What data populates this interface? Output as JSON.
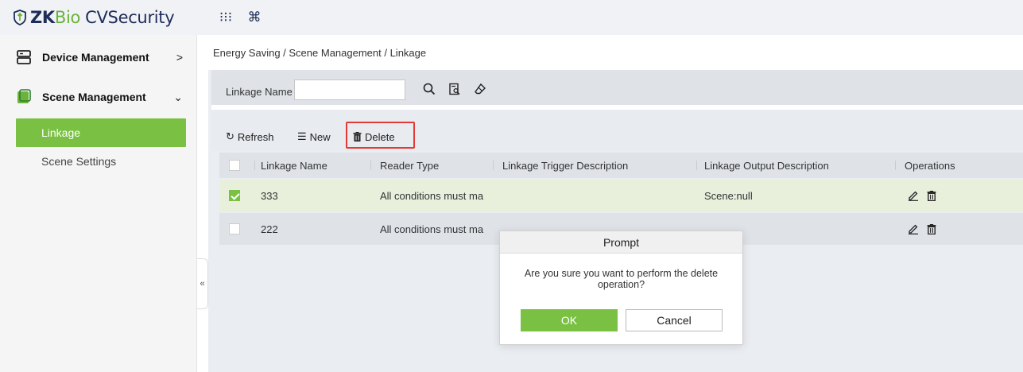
{
  "app": {
    "logo_zk": "ZK",
    "logo_bio": "Bio",
    "logo_cvs": "CVSecurity",
    "grid_icon": "⁝⁝⁝",
    "cmd_icon": "⌘"
  },
  "sidebar": {
    "device_management": "Device Management",
    "scene_management": "Scene Management",
    "sub_items": [
      {
        "label": "Linkage",
        "active": true
      },
      {
        "label": "Scene Settings",
        "active": false
      }
    ],
    "collapse_glyph": "«"
  },
  "breadcrumb": "Energy Saving / Scene Management / Linkage",
  "search": {
    "label": "Linkage Name",
    "value": "",
    "placeholder": ""
  },
  "toolbar": {
    "refresh": "Refresh",
    "new": "New",
    "delete": "Delete"
  },
  "table": {
    "columns": [
      "Linkage Name",
      "Reader Type",
      "Linkage Trigger Description",
      "Linkage Output Description",
      "Operations"
    ],
    "rows": [
      {
        "checked": true,
        "name": "333",
        "reader_type": "All conditions must ma",
        "trigger": "",
        "output": "Scene:null"
      },
      {
        "checked": false,
        "name": "222",
        "reader_type": "All conditions must ma",
        "trigger": "",
        "output": ""
      }
    ]
  },
  "dialog": {
    "title": "Prompt",
    "message": "Are you sure you want to perform the delete operation?",
    "ok": "OK",
    "cancel": "Cancel"
  },
  "colors": {
    "accent": "#7ac143",
    "brand_dark": "#1f2d5a",
    "highlight": "#e53935"
  }
}
